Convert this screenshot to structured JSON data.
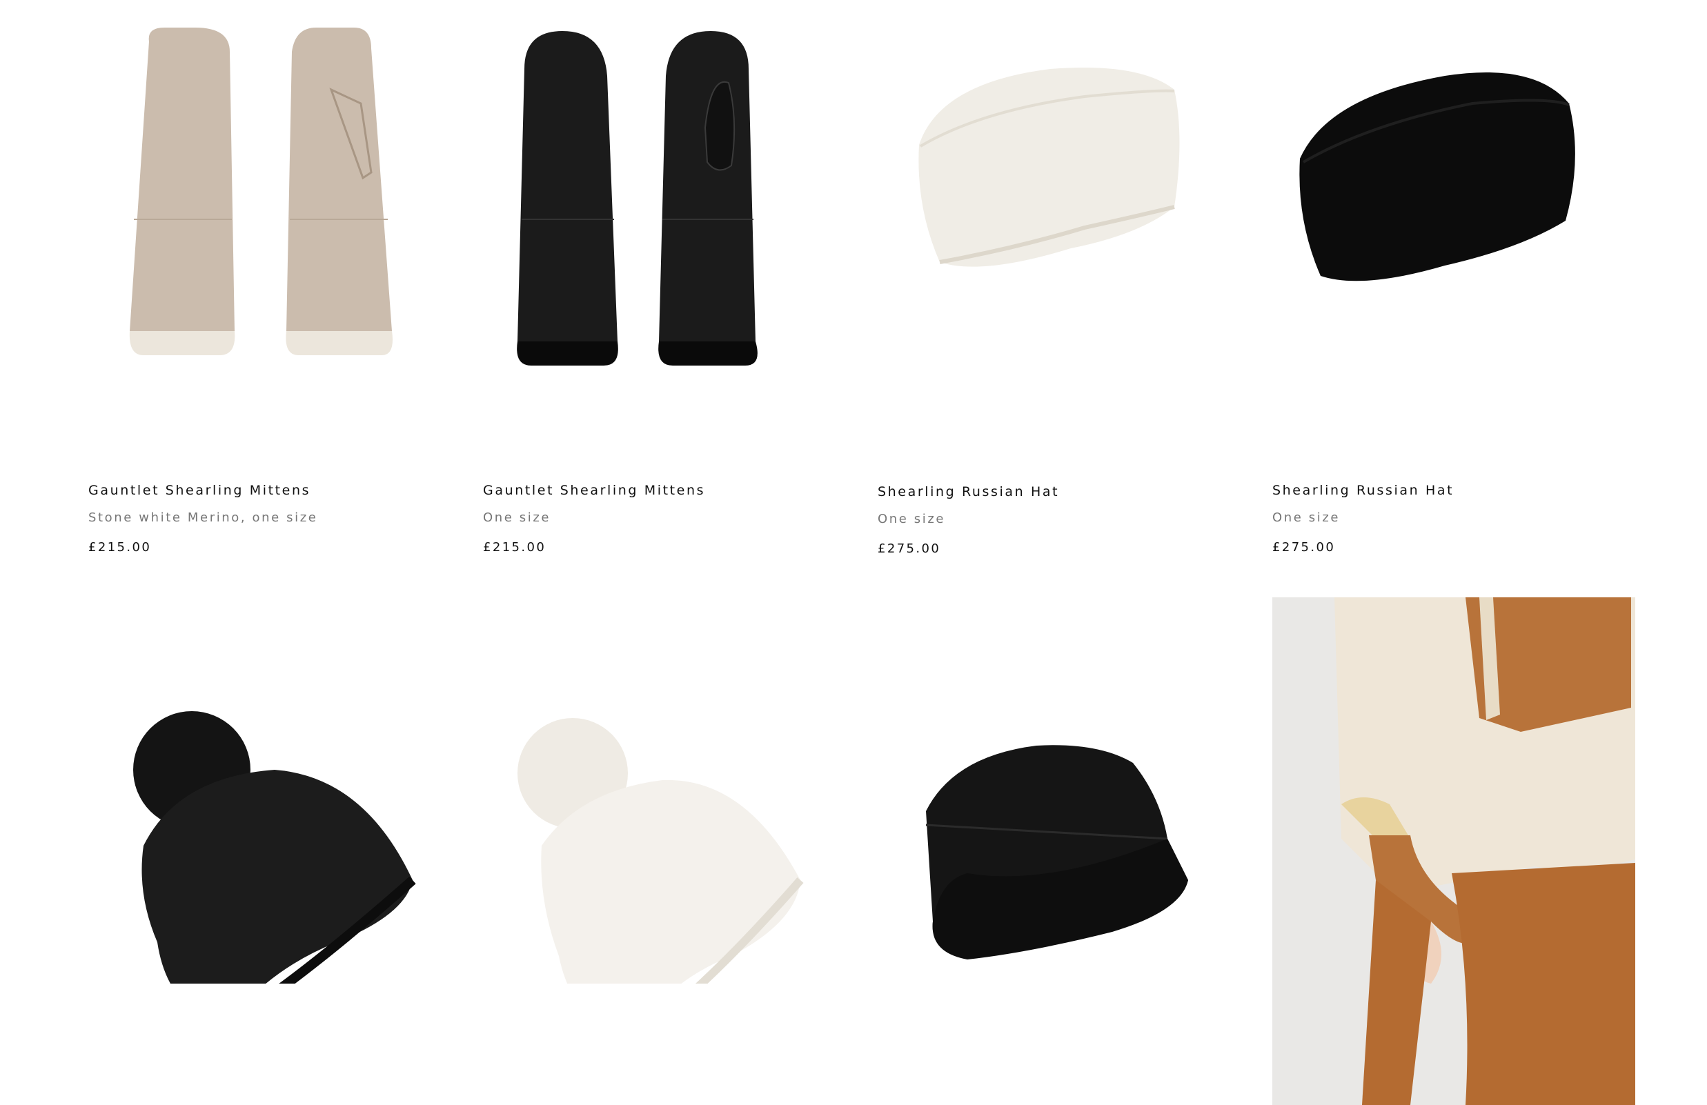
{
  "products": [
    {
      "name": "Gauntlet Shearling Mittens",
      "variant": "Stone white Merino, one size",
      "price": "£215.00",
      "image_icon": "beige-mittens-image"
    },
    {
      "name": "Gauntlet Shearling Mittens",
      "variant": "One size",
      "price": "£215.00",
      "image_icon": "black-mittens-image"
    },
    {
      "name": "Shearling Russian Hat",
      "variant": "One size",
      "price": "£275.00",
      "image_icon": "white-fur-hat-image"
    },
    {
      "name": "Shearling Russian Hat",
      "variant": "One size",
      "price": "£275.00",
      "image_icon": "black-fur-hat-image"
    }
  ],
  "second_row": [
    {
      "image_icon": "black-pompom-beanie-image"
    },
    {
      "image_icon": "white-pompom-beanie-image"
    },
    {
      "image_icon": "black-bucket-hat-image"
    },
    {
      "image_icon": "lifestyle-model-photo"
    }
  ],
  "colors": {
    "background": "#ffffff",
    "text": "#111111",
    "muted": "#777777",
    "accent_tan": "#b8733a"
  }
}
